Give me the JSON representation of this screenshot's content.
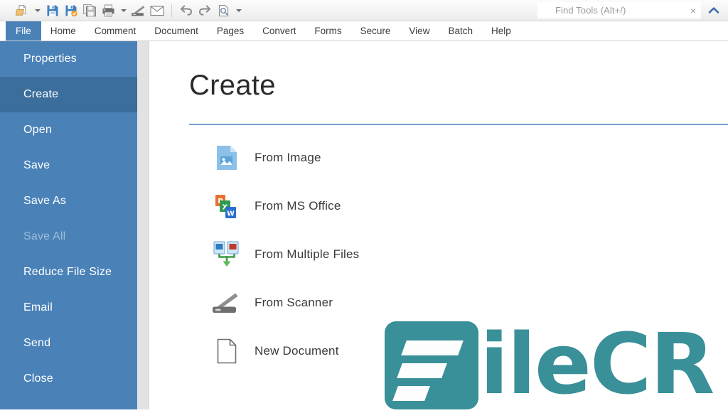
{
  "window": {
    "app_kind": "pdf-editor"
  },
  "quick_access": {
    "items": [
      {
        "name": "open-file-icon",
        "label": "Open"
      },
      {
        "name": "open-dropdown-chevron-icon",
        "label": "Open options"
      },
      {
        "name": "save-icon",
        "label": "Save"
      },
      {
        "name": "save-as-icon",
        "label": "Save As"
      },
      {
        "name": "save-all-icon",
        "label": "Save All"
      },
      {
        "name": "print-icon",
        "label": "Print"
      },
      {
        "name": "print-dropdown-chevron-icon",
        "label": "Print options"
      },
      {
        "name": "scanner-icon",
        "label": "From Scanner"
      },
      {
        "name": "email-icon",
        "label": "Email"
      },
      {
        "name": "undo-icon",
        "label": "Undo"
      },
      {
        "name": "redo-icon",
        "label": "Redo"
      },
      {
        "name": "ocr-preview-icon",
        "label": "OCR / Preview"
      },
      {
        "name": "more-commands-chevron-icon",
        "label": "More commands"
      }
    ]
  },
  "find_tools": {
    "placeholder": "Find Tools  (Alt+/)",
    "close_label": "×"
  },
  "ribbon": {
    "tabs": [
      {
        "label": "File",
        "active": true
      },
      {
        "label": "Home",
        "active": false
      },
      {
        "label": "Comment",
        "active": false
      },
      {
        "label": "Document",
        "active": false
      },
      {
        "label": "Pages",
        "active": false
      },
      {
        "label": "Convert",
        "active": false
      },
      {
        "label": "Forms",
        "active": false
      },
      {
        "label": "Secure",
        "active": false
      },
      {
        "label": "View",
        "active": false
      },
      {
        "label": "Batch",
        "active": false
      },
      {
        "label": "Help",
        "active": false
      }
    ]
  },
  "sidebar": {
    "items": [
      {
        "label": "Properties",
        "state": "normal"
      },
      {
        "label": "Create",
        "state": "active"
      },
      {
        "label": "Open",
        "state": "normal"
      },
      {
        "label": "Save",
        "state": "normal"
      },
      {
        "label": "Save As",
        "state": "normal"
      },
      {
        "label": "Save All",
        "state": "disabled"
      },
      {
        "label": "Reduce File Size",
        "state": "normal"
      },
      {
        "label": "Email",
        "state": "normal"
      },
      {
        "label": "Send",
        "state": "normal"
      },
      {
        "label": "Close",
        "state": "normal"
      }
    ]
  },
  "main": {
    "title": "Create",
    "items": [
      {
        "label": "From Image",
        "icon": "image-document-icon"
      },
      {
        "label": "From MS Office",
        "icon": "ms-office-icon"
      },
      {
        "label": "From Multiple Files",
        "icon": "multiple-files-merge-icon"
      },
      {
        "label": "From Scanner",
        "icon": "scanner-icon"
      },
      {
        "label": "New Document",
        "icon": "blank-document-icon"
      }
    ]
  },
  "watermark": {
    "brand_mark": "filecr-logo-icon",
    "text": "ileCR"
  },
  "colors": {
    "sidebar_blue": "#4a82b8",
    "sidebar_active_blue": "#3b6e9b",
    "title_rule_blue": "#7ba2cc",
    "watermark_teal": "#3a9098",
    "toolbar_bg": "#f3f3f3"
  }
}
